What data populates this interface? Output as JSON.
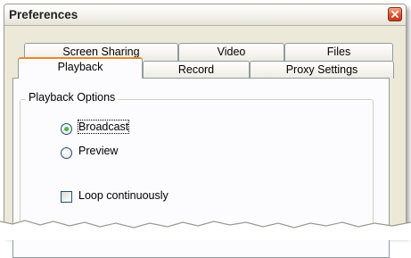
{
  "window": {
    "title": "Preferences"
  },
  "tabs_back": [
    {
      "label": "Screen Sharing"
    },
    {
      "label": "Video"
    },
    {
      "label": "Files"
    }
  ],
  "tabs_front": [
    {
      "label": "Playback",
      "selected": true
    },
    {
      "label": "Record"
    },
    {
      "label": "Proxy Settings"
    }
  ],
  "playback_options": {
    "group_label": "Playback Options",
    "mode_options": [
      {
        "label": "Broadcast",
        "selected": true
      },
      {
        "label": "Preview",
        "selected": false
      }
    ],
    "loop_label": "Loop continuously",
    "loop_checked": false
  },
  "colors": {
    "accent_tab": "#e68b2c",
    "close_button": "#e1532b",
    "radio_dot": "#21a121",
    "dialog_bg": "#ece9d8"
  },
  "icons": {
    "close": "close-icon"
  }
}
